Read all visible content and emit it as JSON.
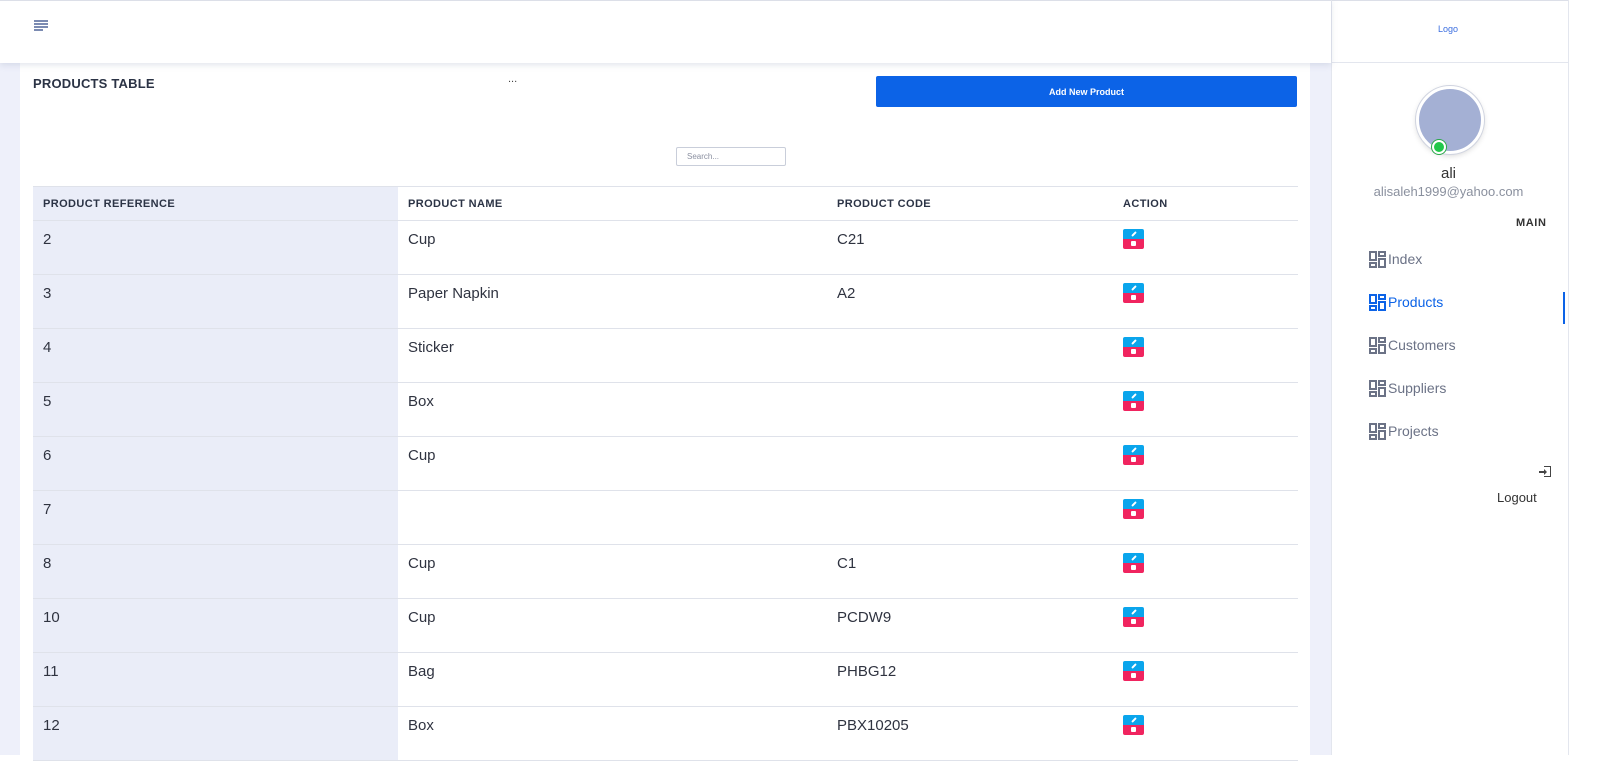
{
  "header": {
    "menu_icon": "menu-lines-icon"
  },
  "card": {
    "title": "PRODUCTS TABLE",
    "dots": "...",
    "add_button_label": "Add New Product",
    "search_placeholder": "Search..."
  },
  "table": {
    "columns": [
      "PRODUCT REFERENCE",
      "PRODUCT NAME",
      "PRODUCT CODE",
      "ACTION"
    ],
    "rows": [
      {
        "ref": "2",
        "name": "Cup",
        "code": "C21"
      },
      {
        "ref": "3",
        "name": "Paper Napkin",
        "code": "A2"
      },
      {
        "ref": "4",
        "name": "Sticker",
        "code": ""
      },
      {
        "ref": "5",
        "name": "Box",
        "code": ""
      },
      {
        "ref": "6",
        "name": "Cup",
        "code": ""
      },
      {
        "ref": "7",
        "name": "",
        "code": ""
      },
      {
        "ref": "8",
        "name": "Cup",
        "code": "C1"
      },
      {
        "ref": "10",
        "name": "Cup",
        "code": "PCDW9"
      },
      {
        "ref": "11",
        "name": "Bag",
        "code": "PHBG12"
      },
      {
        "ref": "12",
        "name": "Box",
        "code": "PBX10205"
      }
    ],
    "action_icons": [
      "pencil-icon",
      "trash-icon"
    ],
    "colors": {
      "edit": "#0aa5ec",
      "delete": "#f0245f"
    }
  },
  "sidebar": {
    "logo": "Logo",
    "user": {
      "name": "ali",
      "email": "alisaleh1999@yahoo.com",
      "status_color": "#21c74a"
    },
    "section_label": "MAIN",
    "items": [
      {
        "label": "Index",
        "icon": "dashboard-icon",
        "active": false
      },
      {
        "label": "Products",
        "icon": "dashboard-icon",
        "active": true
      },
      {
        "label": "Customers",
        "icon": "dashboard-icon",
        "active": false
      },
      {
        "label": "Suppliers",
        "icon": "dashboard-icon",
        "active": false
      },
      {
        "label": "Projects",
        "icon": "dashboard-icon",
        "active": false
      }
    ],
    "logout_label": "Logout",
    "accent_color": "#0c63e7"
  }
}
